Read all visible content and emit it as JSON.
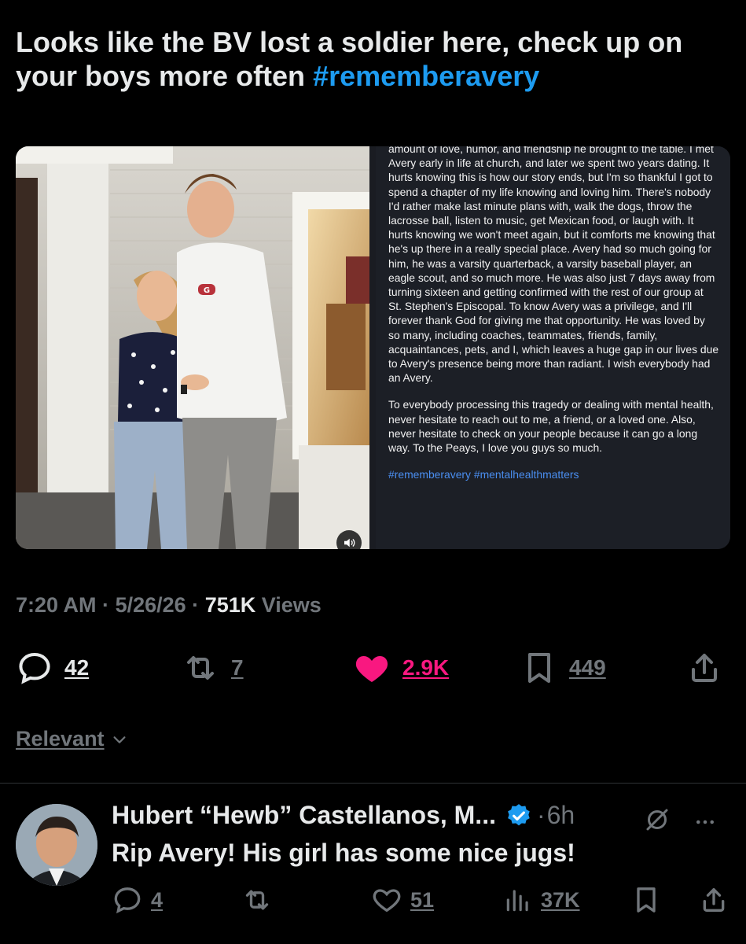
{
  "post": {
    "text": "Looks like the BV lost a soldier here, check up on your boys more often ",
    "hashtag": "#rememberavery"
  },
  "media": {
    "caption_paragraphs": [
      "amount of love, humor, and friendship he brought to the table. I met Avery early in life at church, and later we spent two years dating. It hurts knowing this is how our story ends, but I'm so thankful I got to spend a chapter of my life knowing and loving him. There's nobody I'd rather make last minute plans with, walk the dogs, throw the lacrosse ball, listen to music, get Mexican food, or laugh with. It hurts knowing we won't meet again, but it comforts me knowing that he's up there in a really special place. Avery had so much going for him, he was a varsity quarterback, a varsity baseball player, an eagle scout, and so much more. He was also just 7 days away from turning sixteen and getting confirmed with the rest of our group at St. Stephen's Episcopal. To know Avery was a privilege, and I'll forever thank God for giving me that opportunity. He was loved by so many, including coaches, teammates, friends, family, acquaintances, pets, and I, which leaves a huge gap in our lives due to Avery's presence being more than radiant. I wish everybody had an Avery.",
      "To everybody processing this tragedy or dealing with mental health, never hesitate to reach out to me, a friend, or a loved one. Also, never hesitate to check on your people because it can go a long way. To the Peays, I love you guys so much."
    ],
    "caption_tags": "#rememberavery #mentalhealthmatters",
    "sound_icon": "speaker-icon"
  },
  "meta": {
    "time": "7:20 AM",
    "date": "5/26/26",
    "views_count": "751K",
    "views_label": "Views",
    "sep": "·"
  },
  "actions": {
    "replies": "42",
    "reposts": "7",
    "likes": "2.9K",
    "bookmarks": "449"
  },
  "sort": {
    "label": "Relevant"
  },
  "reply": {
    "author": "Hubert “Hewb” Castellanos, M...",
    "sep": "·",
    "time": "6h",
    "text": "Rip Avery! His girl has some nice jugs!",
    "replies": "4",
    "likes": "51",
    "views": "37K"
  },
  "colors": {
    "background": "#000000",
    "text": "#e7e9ea",
    "muted": "#71767b",
    "accent": "#1d9bf0",
    "like": "#f91880"
  }
}
